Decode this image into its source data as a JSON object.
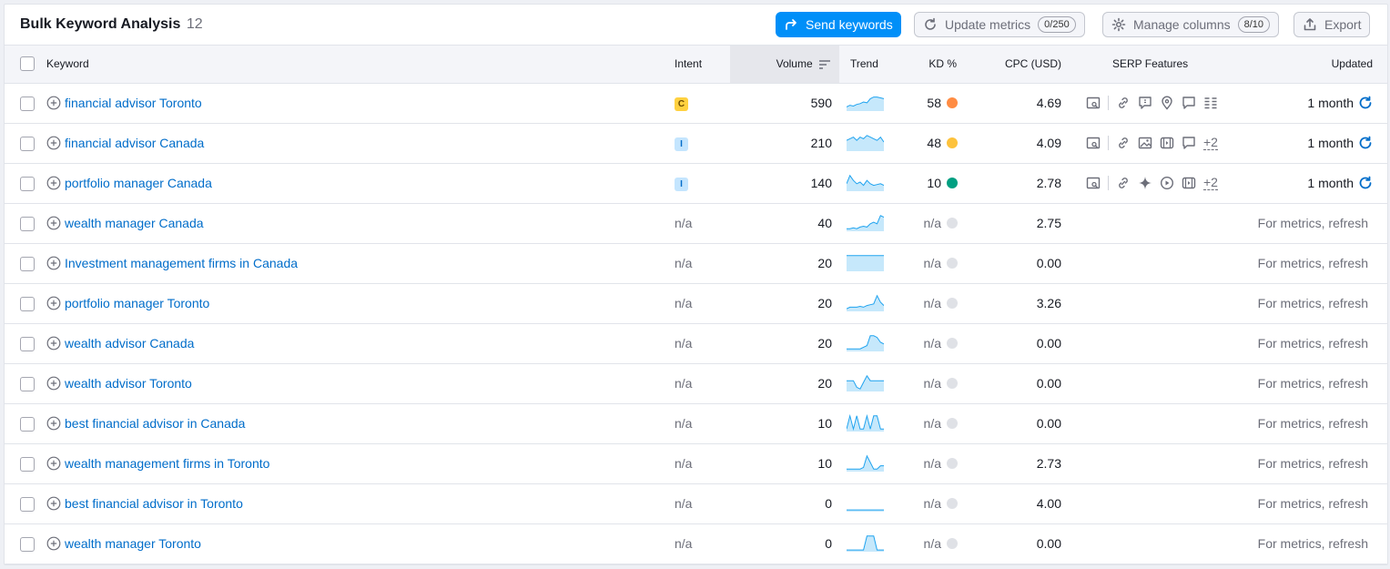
{
  "header": {
    "title": "Bulk Keyword Analysis",
    "count": "12",
    "send_keywords": "Send keywords",
    "update_metrics": "Update metrics",
    "update_badge": "0/250",
    "manage_columns": "Manage columns",
    "manage_badge": "8/10",
    "export": "Export"
  },
  "columns": {
    "keyword": "Keyword",
    "intent": "Intent",
    "volume": "Volume",
    "trend": "Trend",
    "kd": "KD %",
    "cpc": "CPC (USD)",
    "serp": "SERP Features",
    "updated": "Updated"
  },
  "colors": {
    "accent": "#008ff8",
    "link": "#006dca",
    "kd_orange": "#ff8c43",
    "kd_yellow": "#fdc23c",
    "kd_green": "#009f81",
    "kd_gray": "#dfe1e6"
  },
  "rows": [
    {
      "keyword": "financial advisor Toronto",
      "intent": "C",
      "volume": "590",
      "kd": "58",
      "kd_color": "#ff8c43",
      "cpc": "4.69",
      "serp": [
        "serp-magnifier-icon",
        "link-icon",
        "review-icon",
        "local-pin-icon",
        "chat-icon",
        "list-icon"
      ],
      "serp_more": "",
      "updated": "1 month",
      "trend": [
        0.2,
        0.3,
        0.25,
        0.35,
        0.4,
        0.5,
        0.45,
        0.7,
        0.8,
        0.8,
        0.75,
        0.7
      ]
    },
    {
      "keyword": "financial advisor Canada",
      "intent": "I",
      "volume": "210",
      "kd": "48",
      "kd_color": "#fdc23c",
      "cpc": "4.09",
      "serp": [
        "serp-magnifier-icon",
        "link-icon",
        "image-icon",
        "video-icon",
        "chat-icon"
      ],
      "serp_more": "+2",
      "updated": "1 month",
      "trend": [
        0.6,
        0.7,
        0.8,
        0.6,
        0.8,
        0.7,
        0.9,
        0.8,
        0.7,
        0.6,
        0.8,
        0.5
      ]
    },
    {
      "keyword": "portfolio manager Canada",
      "intent": "I",
      "volume": "140",
      "kd": "10",
      "kd_color": "#009f81",
      "cpc": "2.78",
      "serp": [
        "serp-magnifier-icon",
        "link-icon",
        "sparkle-icon",
        "play-icon",
        "video-icon"
      ],
      "serp_more": "+2",
      "updated": "1 month",
      "trend": [
        0.4,
        0.9,
        0.6,
        0.4,
        0.5,
        0.3,
        0.6,
        0.4,
        0.3,
        0.35,
        0.4,
        0.3
      ]
    },
    {
      "keyword": "wealth manager Canada",
      "intent": "n/a",
      "volume": "40",
      "kd": "n/a",
      "kd_color": "#dfe1e6",
      "cpc": "2.75",
      "serp": [],
      "serp_more": "",
      "updated": "For metrics, refresh",
      "trend": [
        0.1,
        0.1,
        0.15,
        0.1,
        0.2,
        0.25,
        0.2,
        0.4,
        0.5,
        0.4,
        0.9,
        0.8
      ]
    },
    {
      "keyword": "Investment management firms in Canada",
      "intent": "n/a",
      "volume": "20",
      "kd": "n/a",
      "kd_color": "#dfe1e6",
      "cpc": "0.00",
      "serp": [],
      "serp_more": "",
      "updated": "For metrics, refresh",
      "trend": [
        0.9,
        0.9,
        0.9,
        0.9,
        0.9,
        0.9,
        0.9,
        0.9,
        0.9,
        0.9,
        0.9,
        0.9
      ]
    },
    {
      "keyword": "portfolio manager Toronto",
      "intent": "n/a",
      "volume": "20",
      "kd": "n/a",
      "kd_color": "#dfe1e6",
      "cpc": "3.26",
      "serp": [],
      "serp_more": "",
      "updated": "For metrics, refresh",
      "trend": [
        0.1,
        0.2,
        0.2,
        0.2,
        0.25,
        0.2,
        0.3,
        0.35,
        0.4,
        0.9,
        0.5,
        0.3
      ]
    },
    {
      "keyword": "wealth advisor Canada",
      "intent": "n/a",
      "volume": "20",
      "kd": "n/a",
      "kd_color": "#dfe1e6",
      "cpc": "0.00",
      "serp": [],
      "serp_more": "",
      "updated": "For metrics, refresh",
      "trend": [
        0.1,
        0.1,
        0.1,
        0.1,
        0.1,
        0.2,
        0.3,
        0.9,
        0.9,
        0.8,
        0.5,
        0.4
      ]
    },
    {
      "keyword": "wealth advisor Toronto",
      "intent": "n/a",
      "volume": "20",
      "kd": "n/a",
      "kd_color": "#dfe1e6",
      "cpc": "0.00",
      "serp": [],
      "serp_more": "",
      "updated": "For metrics, refresh",
      "trend": [
        0.6,
        0.6,
        0.6,
        0.2,
        0.1,
        0.5,
        0.9,
        0.6,
        0.6,
        0.6,
        0.6,
        0.6
      ]
    },
    {
      "keyword": "best financial advisor in Canada",
      "intent": "n/a",
      "volume": "10",
      "kd": "n/a",
      "kd_color": "#dfe1e6",
      "cpc": "0.00",
      "serp": [],
      "serp_more": "",
      "updated": "For metrics, refresh",
      "trend": [
        0.1,
        0.9,
        0.1,
        0.9,
        0.1,
        0.1,
        0.9,
        0.1,
        0.9,
        0.9,
        0.1,
        0.1
      ]
    },
    {
      "keyword": "wealth management firms in Toronto",
      "intent": "n/a",
      "volume": "10",
      "kd": "n/a",
      "kd_color": "#dfe1e6",
      "cpc": "2.73",
      "serp": [],
      "serp_more": "",
      "updated": "For metrics, refresh",
      "trend": [
        0.1,
        0.1,
        0.1,
        0.1,
        0.1,
        0.2,
        0.9,
        0.5,
        0.1,
        0.1,
        0.3,
        0.3
      ]
    },
    {
      "keyword": "best financial advisor in Toronto",
      "intent": "n/a",
      "volume": "0",
      "kd": "n/a",
      "kd_color": "#dfe1e6",
      "cpc": "4.00",
      "serp": [],
      "serp_more": "",
      "updated": "For metrics, refresh",
      "trend": [
        0.05,
        0.05,
        0.05,
        0.05,
        0.05,
        0.05,
        0.05,
        0.05,
        0.05,
        0.05,
        0.05,
        0.05
      ]
    },
    {
      "keyword": "wealth manager Toronto",
      "intent": "n/a",
      "volume": "0",
      "kd": "n/a",
      "kd_color": "#dfe1e6",
      "cpc": "0.00",
      "serp": [],
      "serp_more": "",
      "updated": "For metrics, refresh",
      "trend": [
        0.05,
        0.05,
        0.05,
        0.05,
        0.05,
        0.05,
        0.9,
        0.9,
        0.9,
        0.05,
        0.05,
        0.05
      ]
    }
  ]
}
